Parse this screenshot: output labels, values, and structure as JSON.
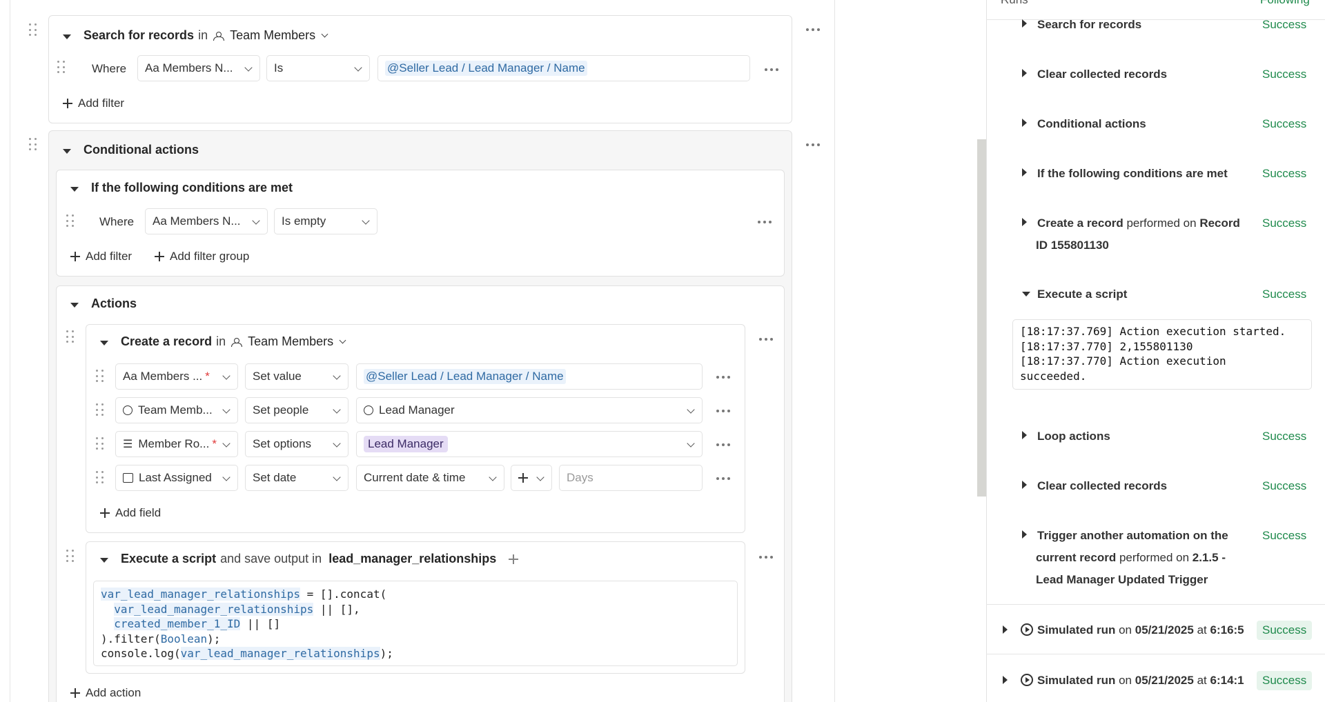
{
  "search_block": {
    "title": "Search for records",
    "in": "in",
    "table": "Team Members",
    "where_label": "Where",
    "field": "Aa Members N...",
    "operator": "Is",
    "value": "@Seller Lead / Lead Manager / Name",
    "add_filter": "Add filter"
  },
  "conditional_block": {
    "title": "Conditional actions",
    "condition": {
      "title": "If the following conditions are met",
      "where_label": "Where",
      "field": "Aa Members N...",
      "operator": "Is empty",
      "add_filter": "Add filter",
      "add_filter_group": "Add filter group"
    },
    "actions": {
      "title": "Actions",
      "create": {
        "title": "Create a record",
        "in": "in",
        "table": "Team Members",
        "rows": [
          {
            "field": "Aa Members ...",
            "required": true,
            "mode": "Set value",
            "value": "@Seller Lead / Lead Manager / Name",
            "value_kind": "token"
          },
          {
            "field": "Team Memb...",
            "required": false,
            "mode": "Set people",
            "value": "Lead Manager",
            "value_kind": "person"
          },
          {
            "field": "Member Ro...",
            "required": true,
            "mode": "Set options",
            "value": "Lead Manager",
            "value_kind": "chip"
          },
          {
            "field": "Last Assigned",
            "required": false,
            "mode": "Set date",
            "value": "Current date & time",
            "value_kind": "date",
            "days_placeholder": "Days"
          }
        ],
        "add_field": "Add field"
      },
      "script": {
        "title": "Execute a script",
        "middle": "and save output in",
        "output_var": "lead_manager_relationships",
        "code_lines": [
          "var_lead_manager_relationships = [].concat(",
          "  var_lead_manager_relationships || [],",
          "  created_member_1_ID || []",
          ").filter(Boolean);",
          "console.log(var_lead_manager_relationships);"
        ]
      },
      "add_action": "Add action"
    }
  },
  "runs": {
    "header_left": "Runs",
    "header_right": "Following",
    "steps": [
      {
        "title": "Search for records",
        "status": "Success"
      },
      {
        "title": "Clear collected records",
        "status": "Success"
      },
      {
        "title": "Conditional actions",
        "status": "Success"
      },
      {
        "title": "If the following conditions are met",
        "status": "Success"
      },
      {
        "title": "Create a record",
        "suffix": "performed on",
        "target": "Record",
        "target_line2": "ID 155801130",
        "status": "Success"
      },
      {
        "title": "Execute a script",
        "status": "Success"
      },
      {
        "title": "Loop actions",
        "status": "Success"
      },
      {
        "title": "Clear collected records",
        "status": "Success"
      },
      {
        "title": "Trigger another automation on the",
        "line2_bold": "current record",
        "line2_normal": "performed on",
        "line2_target": "2.1.5 -",
        "line3": "Lead Manager Updated Trigger",
        "status": "Success"
      }
    ],
    "log_lines": [
      "[18:17:37.769] Action execution started.",
      "[18:17:37.770] 2,155801130",
      "[18:17:37.770] Action execution",
      "succeeded."
    ],
    "simulated": [
      {
        "label": "Simulated run",
        "on": "on",
        "date": "05/21/2025",
        "at": "at",
        "time": "6:16:5",
        "status": "Success"
      },
      {
        "label": "Simulated run",
        "on": "on",
        "date": "05/21/2025",
        "at": "at",
        "time": "6:14:1",
        "status": "Success"
      }
    ]
  }
}
